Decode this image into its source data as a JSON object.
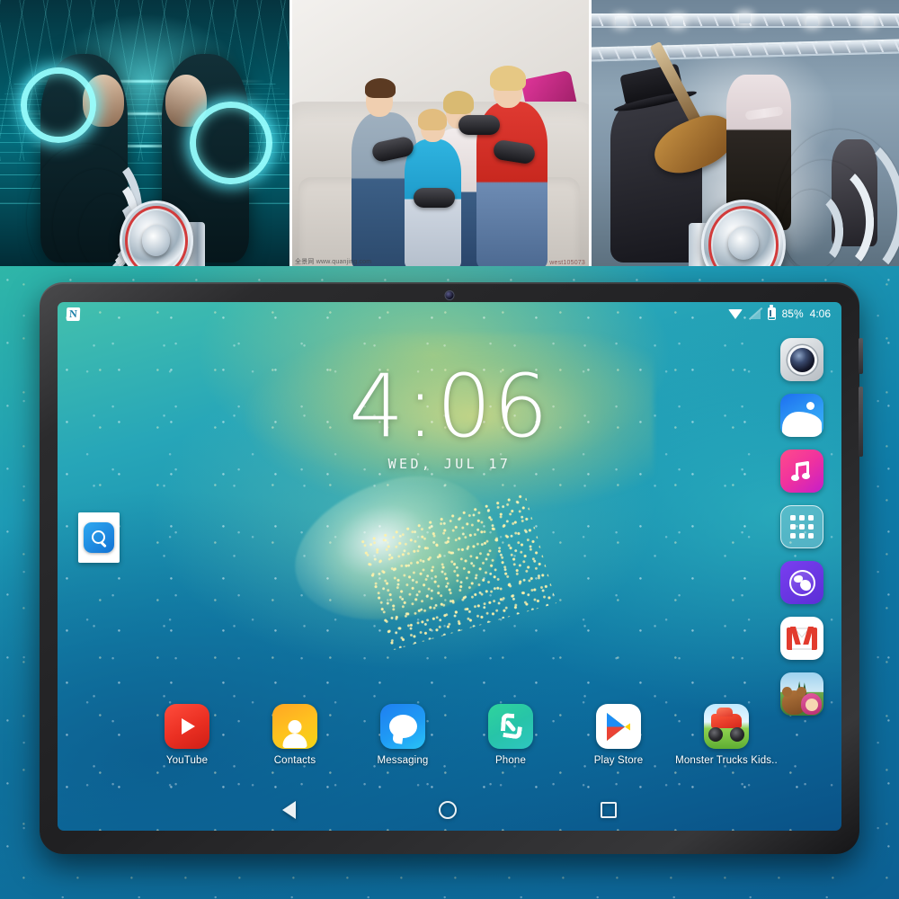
{
  "promo": {
    "panels": [
      {
        "name": "neon-racing-scene",
        "caption": "Two neon-suited figures facing off on a glowing cyan light grid",
        "accent": "#5af0ff"
      },
      {
        "name": "family-gaming-scene",
        "caption": "Family of four playing console games with controllers on a sofa",
        "watermark_left": "全景网  www.quanjing.com",
        "watermark_right": "west105073"
      },
      {
        "name": "rock-concert-scene",
        "caption": "Rock band performing on a lit stage with guitarist and singer",
        "accent": "#e8eef3"
      }
    ],
    "speaker_graphic": {
      "name": "chrome-speaker-soundwave",
      "ring_color": "#d23b3b",
      "chrome_color": "#cfdae3"
    }
  },
  "tablet": {
    "status_bar": {
      "logo_letter": "N",
      "wifi_icon": "wifi-icon",
      "no_signal_icon": "no-signal-icon",
      "battery_icon": "battery-icon",
      "battery_level": "85%",
      "time": "4:06"
    },
    "clock_widget": {
      "time": "4:06",
      "date": "WED, JUL 17"
    },
    "search_widget": {
      "icon": "search-icon",
      "label": ""
    },
    "side_apps": [
      {
        "name": "camera",
        "icon": "camera-icon"
      },
      {
        "name": "gallery",
        "icon": "photos-icon"
      },
      {
        "name": "music",
        "icon": "music-note-icon"
      },
      {
        "name": "app-drawer",
        "icon": "grid-apps-icon"
      },
      {
        "name": "browser",
        "icon": "globe-icon"
      },
      {
        "name": "gmail",
        "icon": "envelope-m-icon"
      },
      {
        "name": "masha",
        "icon": "masha-bear-icon"
      }
    ],
    "dock_apps": [
      {
        "name": "youtube",
        "label": "YouTube",
        "icon": "youtube-play-icon"
      },
      {
        "name": "contacts",
        "label": "Contacts",
        "icon": "person-icon"
      },
      {
        "name": "messaging",
        "label": "Messaging",
        "icon": "chat-bubble-icon"
      },
      {
        "name": "phone",
        "label": "Phone",
        "icon": "handset-icon"
      },
      {
        "name": "play-store",
        "label": "Play Store",
        "icon": "play-triangle-icon"
      },
      {
        "name": "monster-trucks",
        "label": "Monster Trucks Kids..",
        "icon": "monster-truck-icon"
      }
    ],
    "nav_bar": {
      "back": "back-triangle-icon",
      "home": "home-circle-icon",
      "recents": "recents-square-icon"
    },
    "hardware": {
      "front_camera": "front-camera-lens",
      "volume_button": "volume-button",
      "power_button": "power-button"
    }
  },
  "colors": {
    "wallpaper_teal": "#1489ae",
    "wallpaper_green": "#43c0ad",
    "bezel": "#232325",
    "accent_blue": "#1272d4"
  }
}
